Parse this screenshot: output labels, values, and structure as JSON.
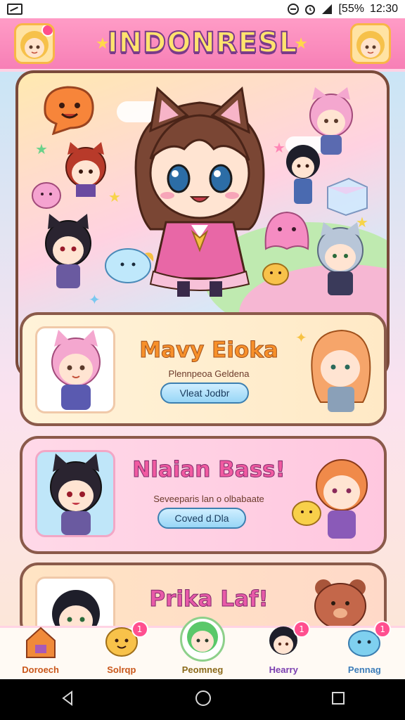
{
  "status_bar": {
    "battery": "[55%",
    "time": "12:30"
  },
  "header": {
    "title": "INDONRESL"
  },
  "cards": [
    {
      "title": "Mavy Eioka",
      "subtitle": "Plennpeoa Geldena",
      "button": "Vleat Jodbr"
    },
    {
      "title": "Nlaian Bass!",
      "subtitle": "Seveeparis lan o olbabaate",
      "button": "Coved d.Dla"
    },
    {
      "title": "Prika Laf!"
    }
  ],
  "bottom_nav": [
    {
      "label": "Doroech",
      "color": "#c9571b",
      "badge": ""
    },
    {
      "label": "Solrqp",
      "color": "#c9571b",
      "badge": "1"
    },
    {
      "label": "Peomneg",
      "color": "#8b6a1b",
      "badge": ""
    },
    {
      "label": "Hearry",
      "color": "#7b3fb0",
      "badge": "1"
    },
    {
      "label": "Pennag",
      "color": "#3d7db9",
      "badge": "1"
    }
  ],
  "colors": {
    "header_pink": "#f77fb6",
    "title_yellow": "#ffe36e",
    "card1_title": "#f7902a",
    "card2_title": "#f15aa1",
    "button_blue": "#98d6f6"
  }
}
